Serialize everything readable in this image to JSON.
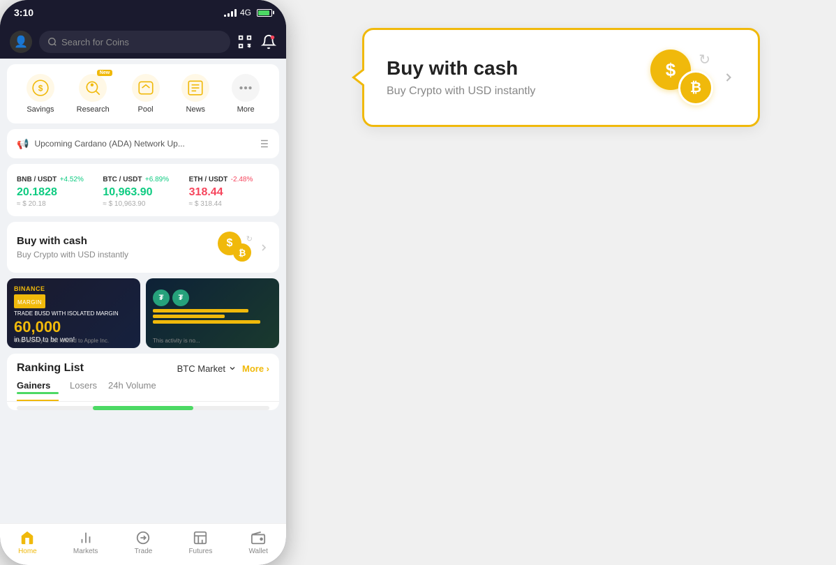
{
  "status": {
    "time": "3:10",
    "network": "4G",
    "battery_level": "80"
  },
  "header": {
    "search_placeholder": "Search for Coins"
  },
  "quick_menu": {
    "items": [
      {
        "id": "savings",
        "label": "Savings",
        "icon": "💰",
        "new_badge": false
      },
      {
        "id": "research",
        "label": "Research",
        "icon": "🔬",
        "new_badge": true
      },
      {
        "id": "pool",
        "label": "Pool",
        "icon": "🏊",
        "new_badge": false
      },
      {
        "id": "news",
        "label": "News",
        "icon": "📰",
        "new_badge": false
      },
      {
        "id": "more",
        "label": "More",
        "icon": "⋯",
        "new_badge": false
      }
    ],
    "new_badge_text": "New"
  },
  "announcement": {
    "text": "Upcoming Cardano (ADA) Network Up...",
    "icon": "📢"
  },
  "prices": [
    {
      "pair": "BNB / USDT",
      "change": "+4.52%",
      "positive": true,
      "value": "20.1828",
      "usd": "≈ $ 20.18"
    },
    {
      "pair": "BTC / USDT",
      "change": "+6.89%",
      "positive": true,
      "value": "10,963.90",
      "usd": "≈ $ 10,963.90"
    },
    {
      "pair": "ETH / USDT",
      "change": "-2.48%",
      "positive": false,
      "value": "318.44",
      "usd": "≈ $ 318.44"
    }
  ],
  "buy_cash": {
    "title": "Buy with cash",
    "subtitle": "Buy Crypto with USD instantly"
  },
  "banners": [
    {
      "label_top": "BINANCE",
      "label_sub": "MARGIN",
      "text1": "TRADE BUSD WITH ISOLATED MARGIN",
      "big_number": "60,000",
      "text2": "in BUSD to be won!",
      "disclaimer": "This activity is not related to Apple Inc."
    },
    {
      "disclaimer": "This activity is no..."
    }
  ],
  "ranking": {
    "title": "Ranking List",
    "market": "BTC Market",
    "more_label": "More",
    "tabs": [
      {
        "label": "Gainers",
        "active": true
      },
      {
        "label": "Losers",
        "active": false
      },
      {
        "label": "24h Volume",
        "active": false
      }
    ]
  },
  "bottom_nav": {
    "items": [
      {
        "id": "home",
        "label": "Home",
        "icon": "🏠",
        "active": true
      },
      {
        "id": "markets",
        "label": "Markets",
        "icon": "📊",
        "active": false
      },
      {
        "id": "trade",
        "label": "Trade",
        "icon": "🔄",
        "active": false
      },
      {
        "id": "futures",
        "label": "Futures",
        "icon": "📈",
        "active": false
      },
      {
        "id": "wallet",
        "label": "Wallet",
        "icon": "👛",
        "active": false
      }
    ]
  },
  "enlarged_card": {
    "title": "Buy with cash",
    "subtitle": "Buy Crypto with USD instantly"
  }
}
